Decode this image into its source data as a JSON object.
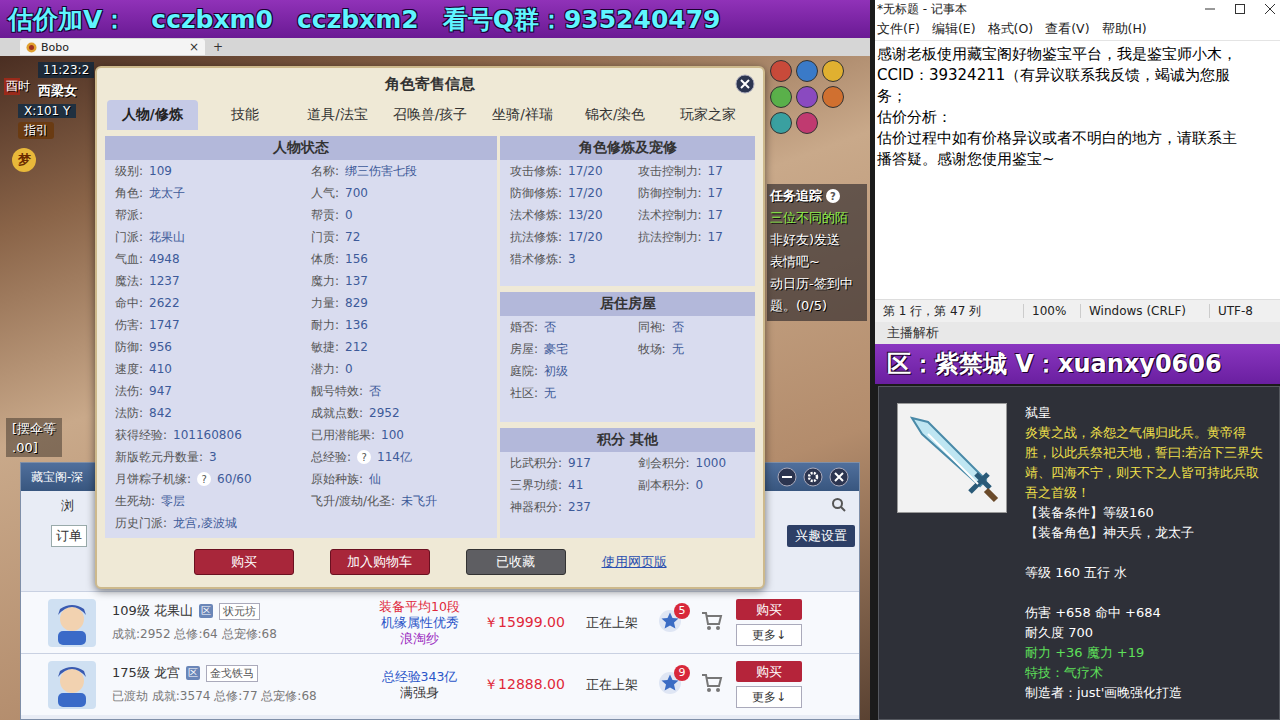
{
  "banner": {
    "segments": [
      "估价加V：",
      "cczbxm0",
      "cczbxm2",
      "看号Q群：935240479"
    ]
  },
  "browser": {
    "tab_title": "Bobo",
    "tab_close": "×",
    "new_tab": "+"
  },
  "hud": {
    "clock": "11:23:2",
    "map": "西梁女",
    "time_of_day": "酉时",
    "coords": "X:101 Y",
    "guide": "指引",
    "dream": "梦",
    "chat": [
      "[摆伞等",
      ".00]"
    ],
    "task_title": "任务追踪",
    "task_help": "?",
    "task_lines": [
      {
        "text": "三位不同的陌",
        "color": "#8cf04a"
      },
      {
        "text": "非好友)发送",
        "color": "#ffffff"
      },
      {
        "text": "表情吧~",
        "color": "#ffffff"
      },
      {
        "text": "动日历-签到中",
        "color": "#ffffff"
      },
      {
        "text": "题。(0/5)",
        "color": "#ffffff"
      }
    ]
  },
  "dialog": {
    "title": "角色寄售信息",
    "tabs": [
      {
        "label": "人物/修炼",
        "selected": true
      },
      {
        "label": "技能",
        "selected": false
      },
      {
        "label": "道具/法宝",
        "selected": false
      },
      {
        "label": "召唤兽/孩子",
        "selected": false
      },
      {
        "label": "坐骑/祥瑞",
        "selected": false
      },
      {
        "label": "锦衣/染色",
        "selected": false
      },
      {
        "label": "玩家之家",
        "selected": false
      }
    ],
    "status": {
      "title": "人物状态",
      "rows": [
        [
          {
            "label": "级别:",
            "value": "109"
          },
          {
            "label": "名称:",
            "value": "绑三伤害七段"
          }
        ],
        [
          {
            "label": "角色:",
            "value": "龙太子"
          },
          {
            "label": "人气:",
            "value": "700"
          }
        ],
        [
          {
            "label": "帮派:"
          },
          {
            "label": "帮贡:",
            "value": "0"
          }
        ],
        [
          {
            "label": "门派:",
            "value": "花果山"
          },
          {
            "label": "门贡:",
            "value": "72"
          }
        ],
        [
          {
            "label": "气血:",
            "value": "4948"
          },
          {
            "label": "体质:",
            "value": "156"
          }
        ],
        [
          {
            "label": "魔法:",
            "value": "1237"
          },
          {
            "label": "魔力:",
            "value": "137"
          }
        ],
        [
          {
            "label": "命中:",
            "value": "2622"
          },
          {
            "label": "力量:",
            "value": "829"
          }
        ],
        [
          {
            "label": "伤害:",
            "value": "1747"
          },
          {
            "label": "耐力:",
            "value": "136"
          }
        ],
        [
          {
            "label": "防御:",
            "value": "956"
          },
          {
            "label": "敏捷:",
            "value": "212"
          }
        ],
        [
          {
            "label": "速度:",
            "value": "410"
          },
          {
            "label": "潜力:",
            "value": "0"
          }
        ],
        [
          {
            "label": "法伤:",
            "value": "947"
          },
          {
            "label": "靓号特效:",
            "value": "否"
          }
        ],
        [
          {
            "label": "法防:",
            "value": "842"
          },
          {
            "label": "成就点数:",
            "value": "2952"
          }
        ],
        [
          {
            "label": "获得经验:",
            "value": "101160806"
          },
          {
            "label": "已用潜能果:",
            "value": "100"
          }
        ],
        [
          {
            "label": "新版乾元丹数量:",
            "value": "3"
          },
          {
            "label": "总经验:",
            "help": "?",
            "value": "114亿"
          }
        ],
        [
          {
            "label": "月饼粽子机缘:",
            "help": "?",
            "value": "60/60"
          },
          {
            "label": "原始种族:",
            "value": "仙"
          }
        ],
        [
          {
            "label": "生死劫:",
            "value": "零层"
          },
          {
            "label": "飞升/渡劫/化圣:",
            "value": "未飞升"
          }
        ],
        [
          {
            "label": "历史门派:",
            "value": "龙宫,凌波城"
          }
        ]
      ]
    },
    "sections": [
      {
        "title": "角色修炼及宠修",
        "rows": [
          [
            {
              "label": "攻击修炼:",
              "value": "17/20"
            },
            {
              "label": "攻击控制力:",
              "value": "17"
            }
          ],
          [
            {
              "label": "防御修炼:",
              "value": "17/20"
            },
            {
              "label": "防御控制力:",
              "value": "17"
            }
          ],
          [
            {
              "label": "法术修炼:",
              "value": "13/20"
            },
            {
              "label": "法术控制力:",
              "value": "17"
            }
          ],
          [
            {
              "label": "抗法修炼:",
              "value": "17/20"
            },
            {
              "label": "抗法控制力:",
              "value": "17"
            }
          ],
          [
            {
              "label": "猎术修炼:",
              "value": "3"
            }
          ]
        ]
      },
      {
        "title": "居住房屋",
        "rows": [
          [
            {
              "label": "婚否:",
              "value": "否"
            },
            {
              "label": "同袍:",
              "value": "否"
            }
          ],
          [
            {
              "label": "房屋:",
              "value": "豪宅"
            },
            {
              "label": "牧场:",
              "value": "无"
            }
          ],
          [
            {
              "label": "庭院:",
              "value": "初级"
            }
          ],
          [
            {
              "label": "社区:",
              "value": "无"
            }
          ]
        ]
      },
      {
        "title": "积分 其他",
        "rows": [
          [
            {
              "label": "比武积分:",
              "value": "917"
            },
            {
              "label": "剑会积分:",
              "value": "1000"
            }
          ],
          [
            {
              "label": "三界功绩:",
              "value": "41"
            },
            {
              "label": "副本积分:",
              "value": "0"
            }
          ],
          [
            {
              "label": "神器积分:",
              "value": "237"
            }
          ]
        ]
      }
    ],
    "buttons": [
      {
        "label": "购买",
        "kind": "primary"
      },
      {
        "label": "加入购物车",
        "kind": "primary"
      },
      {
        "label": "已收藏",
        "kind": "done"
      },
      {
        "label": "使用网页版",
        "kind": "link"
      }
    ]
  },
  "shop": {
    "title": "藏宝阁-深",
    "browse": "浏",
    "order": "订单",
    "interest": "兴趣设置",
    "rows": [
      {
        "level_school": "109级 花果山",
        "zone": "区",
        "server": "状元坊",
        "stats": "成就:2952 总修:64 总宠修:68",
        "tags": [
          {
            "text": "装备平均10段",
            "color": "#e0283a"
          },
          {
            "text": "机缘属性优秀",
            "color": "#2a55c8"
          },
          {
            "text": "浪淘纱",
            "color": "#9a2ac0"
          }
        ],
        "price": "￥15999.00",
        "status": "正在上架",
        "fav_count": "5",
        "buy": "购买",
        "more": "更多↓"
      },
      {
        "level_school": "175级 龙宫",
        "zone": "区",
        "server": "金戈铁马",
        "stats": "已渡劫 成就:3574 总修:77 总宠修:68",
        "tags": [
          {
            "text": "总经验343亿",
            "color": "#2a55c8"
          },
          {
            "text": "满强身",
            "color": "#333333"
          }
        ],
        "price": "￥12888.00",
        "status": "正在上架",
        "fav_count": "9",
        "buy": "购买",
        "more": "更多↓"
      }
    ]
  },
  "notepad": {
    "title": "*无标题 - 记事本",
    "menu": [
      "文件(F)",
      "编辑(E)",
      "格式(O)",
      "查看(V)",
      "帮助(H)"
    ],
    "lines": [
      "感谢老板使用藏宝阁好物鉴宝平台，我是鉴宝师小木，",
      "CCID：39324211（有异议联系我反馈，竭诚为您服",
      "务；",
      "估价分析：",
      "估价过程中如有价格异议或者不明白的地方，请联系主",
      "播答疑。感谢您使用鉴宝~"
    ],
    "status": [
      "第 1 行，第 47 列",
      "100%",
      "Windows (CRLF)",
      "UTF-8"
    ]
  },
  "analysis": "主播解析",
  "zone": "区：紫禁城 V：xuanxy0606",
  "tooltip": {
    "name": "弑皇",
    "description": [
      "炎黄之战，杀怨之气偶归此兵。黄帝得",
      "胜，以此兵祭祀天地，誓曰:若治下三界失",
      "靖、四海不宁，则天下之人皆可持此兵取",
      "吾之首级！"
    ],
    "groups": [
      [
        {
          "text": "【装备条件】等级160",
          "color": "#ffffff"
        },
        {
          "text": "【装备角色】神天兵，龙太子",
          "color": "#ffffff"
        }
      ],
      [
        {
          "text": "等级 160 五行 水",
          "color": "#ffffff"
        }
      ],
      [
        {
          "text": "伤害 +658 命中 +684",
          "color": "#ffffff"
        },
        {
          "text": "耐久度 700",
          "color": "#ffffff"
        },
        {
          "text": "耐力 +36 魔力 +19",
          "color": "#5ee05a"
        },
        {
          "text": "特技：气疗术",
          "color": "#5ee05a"
        },
        {
          "text": "制造者：just'画晚强化打造",
          "color": "#ffffff"
        }
      ]
    ]
  }
}
